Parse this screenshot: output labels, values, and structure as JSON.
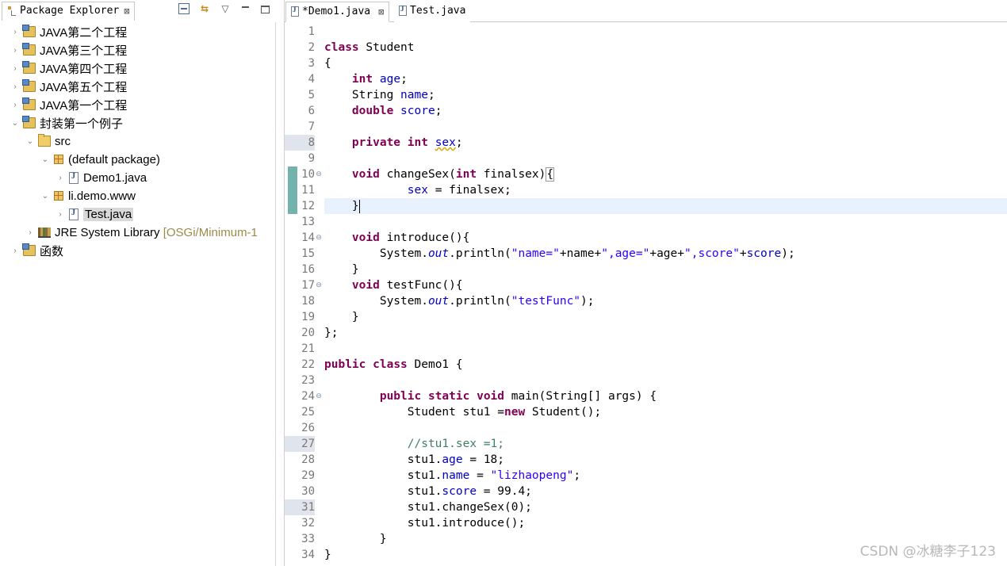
{
  "explorer": {
    "tab_label": "Package Explorer",
    "close_glyph": "⊠",
    "tools": {
      "menu_glyph": "▽"
    },
    "tree": [
      {
        "label": "JAVA第二个工程",
        "icon": "project-icon",
        "twisty": "›"
      },
      {
        "label": "JAVA第三个工程",
        "icon": "project-icon",
        "twisty": "›"
      },
      {
        "label": "JAVA第四个工程",
        "icon": "project-icon",
        "twisty": "›"
      },
      {
        "label": "JAVA第五个工程",
        "icon": "project-icon",
        "twisty": "›"
      },
      {
        "label": "JAVA第一个工程",
        "icon": "project-icon",
        "twisty": "›"
      },
      {
        "label": "封装第一个例子",
        "icon": "project-icon",
        "twisty": "⌄"
      },
      {
        "label": "src",
        "icon": "folder-icon",
        "twisty": "⌄"
      },
      {
        "label": "(default package)",
        "icon": "package-icon",
        "twisty": "⌄"
      },
      {
        "label": "Demo1.java",
        "icon": "java-file-icon",
        "twisty": "›"
      },
      {
        "label": "li.demo.www",
        "icon": "package-icon",
        "twisty": "⌄"
      },
      {
        "label": "Test.java",
        "icon": "java-file-icon",
        "twisty": "›"
      },
      {
        "label": "JRE System Library",
        "decoration": "[OSGi/Minimum-1",
        "icon": "library-icon",
        "twisty": "›"
      },
      {
        "label": "函数",
        "icon": "project-icon",
        "twisty": "›"
      }
    ]
  },
  "editor": {
    "tabs": [
      {
        "label": "*Demo1.java",
        "close": "⊠"
      },
      {
        "label": "Test.java"
      }
    ],
    "line_numbers": [
      "1",
      "2",
      "3",
      "4",
      "5",
      "6",
      "7",
      "8",
      "9",
      "10",
      "11",
      "12",
      "13",
      "14",
      "15",
      "16",
      "17",
      "18",
      "19",
      "20",
      "21",
      "22",
      "23",
      "24",
      "25",
      "26",
      "27",
      "28",
      "29",
      "30",
      "31",
      "32",
      "33",
      "34"
    ],
    "fold_glyph": "⊖",
    "code": {
      "l2_kw": "class",
      "l2_rest": " Student",
      "l3": "{",
      "l4_kw": "int",
      "l4_fld": "age",
      "l4_end": ";",
      "l5_type": "String ",
      "l5_fld": "name",
      "l5_end": ";",
      "l6_kw": "double",
      "l6_fld": "score",
      "l6_end": ";",
      "l8_kw1": "private",
      "l8_kw2": "int",
      "l8_fld": "sex",
      "l8_end": ";",
      "l10_kw": "void",
      "l10_mid": " changeSex(",
      "l10_kw2": "int",
      "l10_rest": " finalsex)",
      "l10_brace": "{",
      "l11_fld": "sex",
      "l11_rest": " = finalsex;",
      "l12_brace": "}",
      "l14_kw": "void",
      "l14_rest": " introduce(){",
      "l15_a": "System.",
      "l15_out": "out",
      "l15_b": ".println(",
      "l15_s1": "\"name=\"",
      "l15_c": "+name+",
      "l15_s2": "\",age=\"",
      "l15_d": "+age+",
      "l15_s3": "\",score\"",
      "l15_e": "+",
      "l15_fld": "score",
      "l15_f": ");",
      "l16": "}",
      "l17_kw": "void",
      "l17_rest": " testFunc(){",
      "l18_a": "System.",
      "l18_out": "out",
      "l18_b": ".println(",
      "l18_s": "\"testFunc\"",
      "l18_c": ");",
      "l19": "}",
      "l20": "};",
      "l22_kw1": "public",
      "l22_kw2": "class",
      "l22_rest": " Demo1 {",
      "l24_kw1": "public",
      "l24_kw2": "static",
      "l24_kw3": "void",
      "l24_rest": " main(String[] args) {",
      "l25_a": "Student stu1 =",
      "l25_kw": "new",
      "l25_b": " Student();",
      "l27_cmt": "//stu1.sex =1;",
      "l28_a": "stu1.",
      "l28_fld": "age",
      "l28_b": " = 18;",
      "l29_a": "stu1.",
      "l29_fld": "name",
      "l29_b": " = ",
      "l29_s": "\"lizhaopeng\"",
      "l29_c": ";",
      "l30_a": "stu1.",
      "l30_fld": "score",
      "l30_b": " = 99.4;",
      "l31": "stu1.changeSex(0);",
      "l32": "stu1.introduce();",
      "l33": "}",
      "l34": "}"
    }
  },
  "watermark": "CSDN @冰糖李子123"
}
